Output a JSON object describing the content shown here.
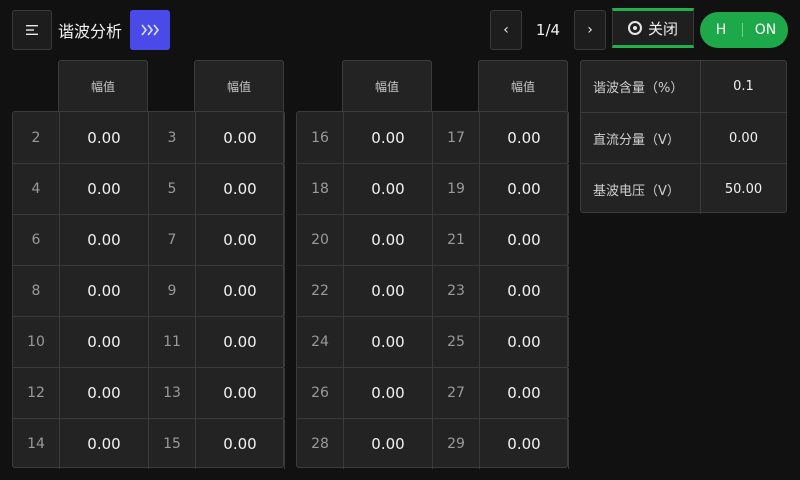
{
  "header": {
    "title": "谐波分析",
    "menu_icon": "menu-icon",
    "forward_icon": "triple-chevron-right-icon",
    "prev_glyph": "‹",
    "next_glyph": "›",
    "page": "1/4",
    "close_label": "关闭",
    "toggle_left": "H",
    "toggle_right": "ON",
    "accent_color": "#4a4ae8",
    "status_color": "#22b14c"
  },
  "table_header": "幅值",
  "harmonics": {
    "col1": [
      {
        "order": "2",
        "value": "0.00"
      },
      {
        "order": "4",
        "value": "0.00"
      },
      {
        "order": "6",
        "value": "0.00"
      },
      {
        "order": "8",
        "value": "0.00"
      },
      {
        "order": "10",
        "value": "0.00"
      },
      {
        "order": "12",
        "value": "0.00"
      },
      {
        "order": "14",
        "value": "0.00"
      }
    ],
    "col2": [
      {
        "order": "3",
        "value": "0.00"
      },
      {
        "order": "5",
        "value": "0.00"
      },
      {
        "order": "7",
        "value": "0.00"
      },
      {
        "order": "9",
        "value": "0.00"
      },
      {
        "order": "11",
        "value": "0.00"
      },
      {
        "order": "13",
        "value": "0.00"
      },
      {
        "order": "15",
        "value": "0.00"
      }
    ],
    "col3": [
      {
        "order": "16",
        "value": "0.00"
      },
      {
        "order": "18",
        "value": "0.00"
      },
      {
        "order": "20",
        "value": "0.00"
      },
      {
        "order": "22",
        "value": "0.00"
      },
      {
        "order": "24",
        "value": "0.00"
      },
      {
        "order": "26",
        "value": "0.00"
      },
      {
        "order": "28",
        "value": "0.00"
      }
    ],
    "col4": [
      {
        "order": "17",
        "value": "0.00"
      },
      {
        "order": "19",
        "value": "0.00"
      },
      {
        "order": "21",
        "value": "0.00"
      },
      {
        "order": "23",
        "value": "0.00"
      },
      {
        "order": "25",
        "value": "0.00"
      },
      {
        "order": "27",
        "value": "0.00"
      },
      {
        "order": "29",
        "value": "0.00"
      }
    ]
  },
  "summary": [
    {
      "label": "谐波含量（%）",
      "value": "0.1"
    },
    {
      "label": "直流分量（V）",
      "value": "0.00"
    },
    {
      "label": "基波电压（V）",
      "value": "50.00"
    }
  ]
}
